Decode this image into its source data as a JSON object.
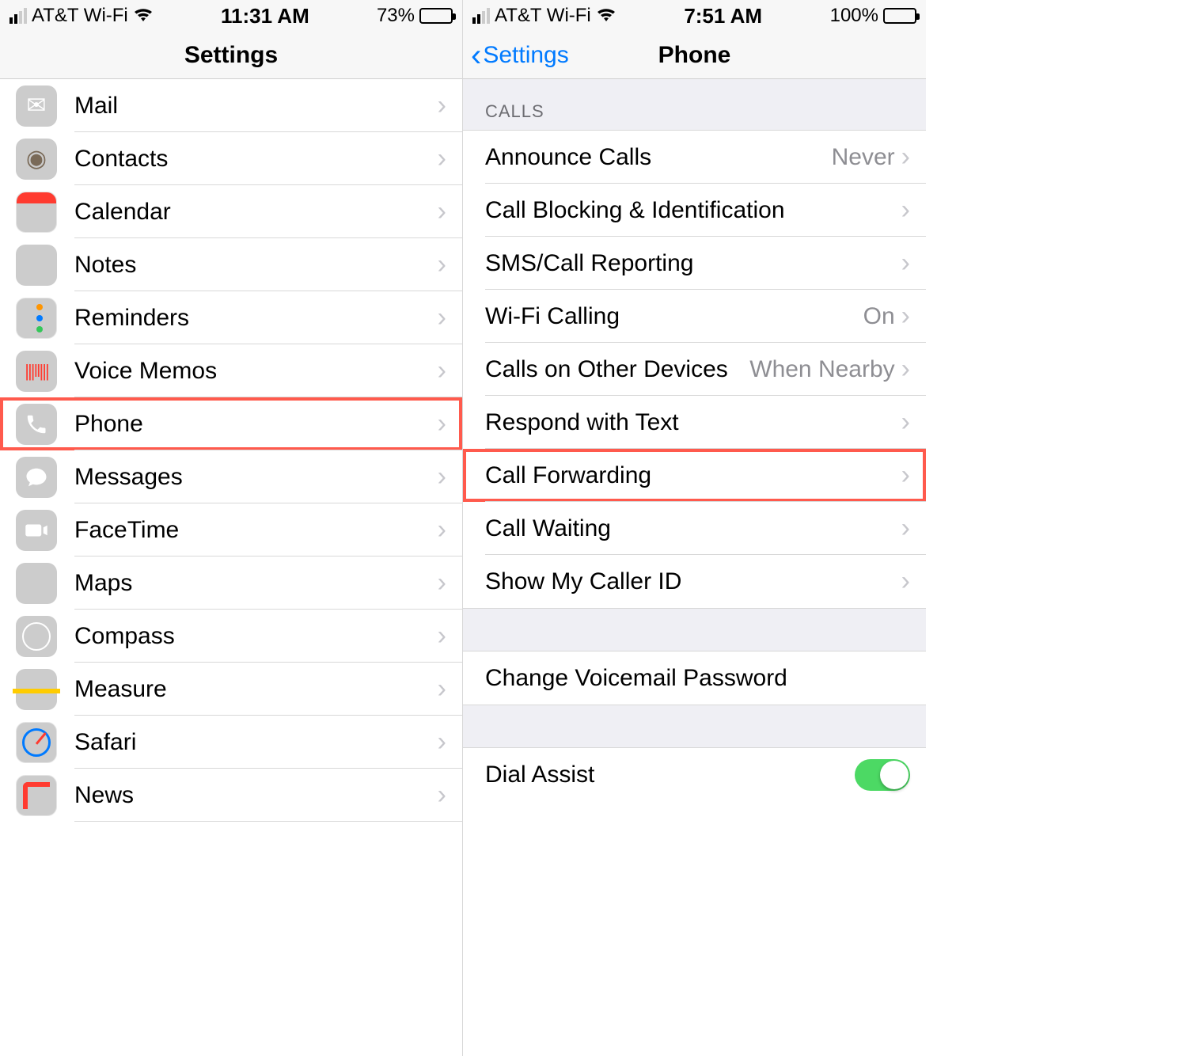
{
  "left": {
    "status": {
      "carrier": "AT&T Wi-Fi",
      "time": "11:31 AM",
      "battery_pct": "73%",
      "battery_fill": 73
    },
    "title": "Settings",
    "rows": [
      {
        "key": "mail",
        "label": "Mail"
      },
      {
        "key": "contacts",
        "label": "Contacts"
      },
      {
        "key": "calendar",
        "label": "Calendar"
      },
      {
        "key": "notes",
        "label": "Notes"
      },
      {
        "key": "reminders",
        "label": "Reminders"
      },
      {
        "key": "voicememos",
        "label": "Voice Memos"
      },
      {
        "key": "phone",
        "label": "Phone",
        "highlight": true
      },
      {
        "key": "messages",
        "label": "Messages"
      },
      {
        "key": "facetime",
        "label": "FaceTime"
      },
      {
        "key": "maps",
        "label": "Maps"
      },
      {
        "key": "compass",
        "label": "Compass"
      },
      {
        "key": "measure",
        "label": "Measure"
      },
      {
        "key": "safari",
        "label": "Safari"
      },
      {
        "key": "news",
        "label": "News"
      }
    ]
  },
  "right": {
    "status": {
      "carrier": "AT&T Wi-Fi",
      "time": "7:51 AM",
      "battery_pct": "100%",
      "battery_fill": 100
    },
    "back_label": "Settings",
    "title": "Phone",
    "section_calls": "CALLS",
    "rows_calls": [
      {
        "key": "announce",
        "label": "Announce Calls",
        "value": "Never"
      },
      {
        "key": "blocking",
        "label": "Call Blocking & Identification"
      },
      {
        "key": "sms",
        "label": "SMS/Call Reporting"
      },
      {
        "key": "wifi",
        "label": "Wi-Fi Calling",
        "value": "On"
      },
      {
        "key": "otherdev",
        "label": "Calls on Other Devices",
        "value": "When Nearby"
      },
      {
        "key": "respond",
        "label": "Respond with Text"
      },
      {
        "key": "forwarding",
        "label": "Call Forwarding",
        "highlight": true
      },
      {
        "key": "waiting",
        "label": "Call Waiting"
      },
      {
        "key": "callerid",
        "label": "Show My Caller ID"
      }
    ],
    "voicemail_link": "Change Voicemail Password",
    "dial_assist": "Dial Assist"
  }
}
